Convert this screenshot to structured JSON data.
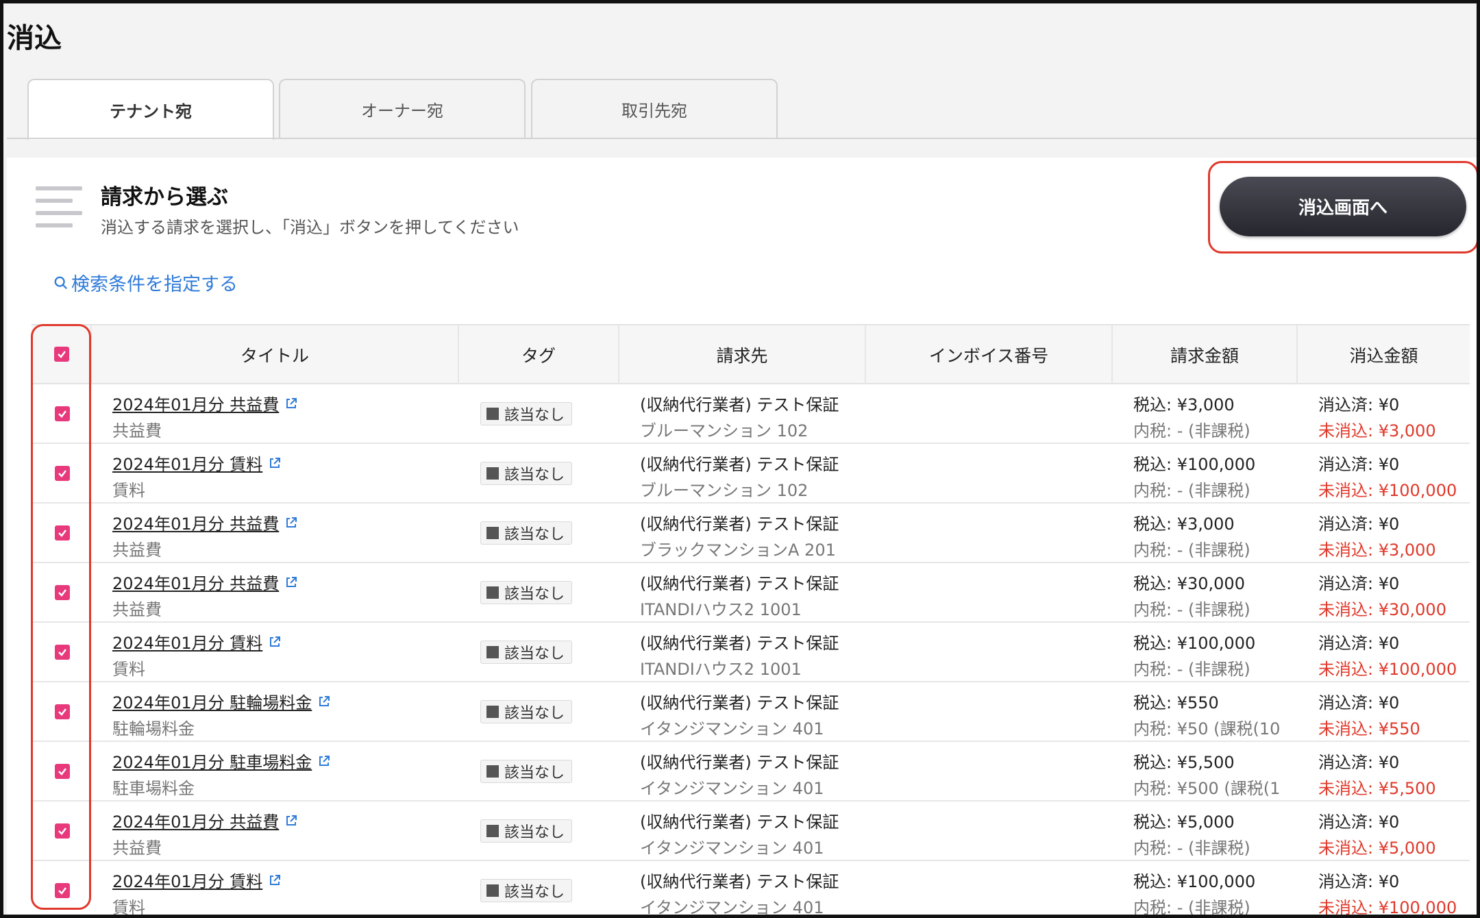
{
  "page": {
    "title": "消込"
  },
  "tabs": [
    {
      "label": "テナント宛",
      "active": true
    },
    {
      "label": "オーナー宛",
      "active": false
    },
    {
      "label": "取引先宛",
      "active": false
    }
  ],
  "section": {
    "title": "請求から選ぶ",
    "subtitle": "消込する請求を選択し、「消込」ボタンを押してください",
    "go_button": "消込画面へ",
    "search_link": "検索条件を指定する"
  },
  "table": {
    "headers": {
      "title": "タイトル",
      "tag": "タグ",
      "billing_to": "請求先",
      "invoice_no": "インボイス番号",
      "billed": "請求金額",
      "cleared": "消込金額"
    },
    "rows": [
      {
        "title": "2024年01月分 共益費",
        "category": "共益費",
        "tag": "該当なし",
        "payer": "(収納代行業者) テスト保証",
        "property": "ブルーマンション 102",
        "invoice": "",
        "tax_in": "税込: ¥3,000",
        "tax_inner": "内税: - (非課税)",
        "cleared": "消込済: ¥0",
        "uncleared": "未消込: ¥3,000"
      },
      {
        "title": "2024年01月分 賃料",
        "category": "賃料",
        "tag": "該当なし",
        "payer": "(収納代行業者) テスト保証",
        "property": "ブルーマンション 102",
        "invoice": "",
        "tax_in": "税込: ¥100,000",
        "tax_inner": "内税: - (非課税)",
        "cleared": "消込済: ¥0",
        "uncleared": "未消込: ¥100,000"
      },
      {
        "title": "2024年01月分 共益費",
        "category": "共益費",
        "tag": "該当なし",
        "payer": "(収納代行業者) テスト保証",
        "property": "ブラックマンションA 201",
        "invoice": "",
        "tax_in": "税込: ¥3,000",
        "tax_inner": "内税: - (非課税)",
        "cleared": "消込済: ¥0",
        "uncleared": "未消込: ¥3,000"
      },
      {
        "title": "2024年01月分 共益費",
        "category": "共益費",
        "tag": "該当なし",
        "payer": "(収納代行業者) テスト保証",
        "property": "ITANDIハウス2 1001",
        "invoice": "",
        "tax_in": "税込: ¥30,000",
        "tax_inner": "内税: - (非課税)",
        "cleared": "消込済: ¥0",
        "uncleared": "未消込: ¥30,000"
      },
      {
        "title": "2024年01月分 賃料",
        "category": "賃料",
        "tag": "該当なし",
        "payer": "(収納代行業者) テスト保証",
        "property": "ITANDIハウス2 1001",
        "invoice": "",
        "tax_in": "税込: ¥100,000",
        "tax_inner": "内税: - (非課税)",
        "cleared": "消込済: ¥0",
        "uncleared": "未消込: ¥100,000"
      },
      {
        "title": "2024年01月分 駐輪場料金",
        "category": "駐輪場料金",
        "tag": "該当なし",
        "payer": "(収納代行業者) テスト保証",
        "property": "イタンジマンション 401",
        "invoice": "",
        "tax_in": "税込: ¥550",
        "tax_inner": "内税: ¥50 (課税(10",
        "cleared": "消込済: ¥0",
        "uncleared": "未消込: ¥550"
      },
      {
        "title": "2024年01月分 駐車場料金",
        "category": "駐車場料金",
        "tag": "該当なし",
        "payer": "(収納代行業者) テスト保証",
        "property": "イタンジマンション 401",
        "invoice": "",
        "tax_in": "税込: ¥5,500",
        "tax_inner": "内税: ¥500 (課税(1",
        "cleared": "消込済: ¥0",
        "uncleared": "未消込: ¥5,500"
      },
      {
        "title": "2024年01月分 共益費",
        "category": "共益費",
        "tag": "該当なし",
        "payer": "(収納代行業者) テスト保証",
        "property": "イタンジマンション 401",
        "invoice": "",
        "tax_in": "税込: ¥5,000",
        "tax_inner": "内税: - (非課税)",
        "cleared": "消込済: ¥0",
        "uncleared": "未消込: ¥5,000"
      },
      {
        "title": "2024年01月分 賃料",
        "category": "賃料",
        "tag": "該当なし",
        "payer": "(収納代行業者) テスト保証",
        "property": "イタンジマンション 401",
        "invoice": "",
        "tax_in": "税込: ¥100,000",
        "tax_inner": "内税: - (非課税)",
        "cleared": "消込済: ¥0",
        "uncleared": "未消込: ¥100,000"
      }
    ]
  },
  "colors": {
    "accent": "#e8397d",
    "highlight": "#e0392b",
    "link": "#2f7bd9",
    "button": "#2e2e36"
  },
  "icons": {
    "menu": "menu-lines-icon",
    "search": "search-icon",
    "external": "external-link-icon",
    "checkbox": "checkbox-checked-icon"
  }
}
